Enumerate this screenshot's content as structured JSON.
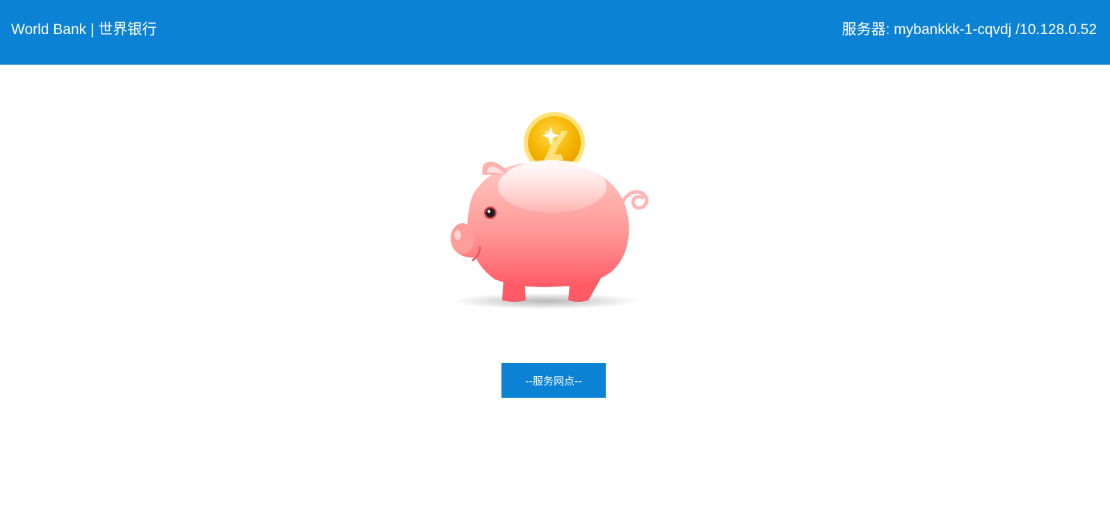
{
  "header": {
    "brand": "World Bank | 世界银行",
    "server": "服务器: mybankkk-1-cqvdj /10.128.0.52",
    "background_color": "#0b82d4"
  },
  "hero": {
    "icon": "piggy-bank-with-coin"
  },
  "main": {
    "button_label": "--服务网点--"
  }
}
